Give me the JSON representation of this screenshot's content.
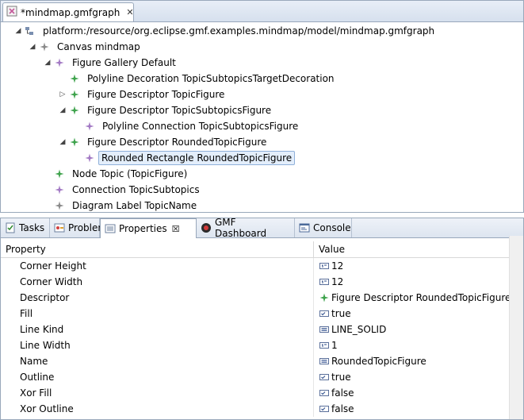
{
  "editor": {
    "tab_label": "*mindmap.gmfgraph",
    "tree": [
      {
        "label": "platform:/resource/org.eclipse.gmf.examples.mindmap/model/mindmap.gmfgraph",
        "twisty": "◢",
        "icon": "resource"
      },
      {
        "label": "Canvas mindmap",
        "twisty": "◢",
        "icon": "gray"
      },
      {
        "label": "Figure Gallery Default",
        "twisty": "◢",
        "icon": "purple"
      },
      {
        "label": "Polyline Decoration TopicSubtopicsTargetDecoration",
        "twisty": "",
        "icon": "green"
      },
      {
        "label": "Figure Descriptor TopicFigure",
        "twisty": "▷",
        "icon": "green"
      },
      {
        "label": "Figure Descriptor TopicSubtopicsFigure",
        "twisty": "◢",
        "icon": "green"
      },
      {
        "label": "Polyline Connection TopicSubtopicsFigure",
        "twisty": "",
        "icon": "purple"
      },
      {
        "label": "Figure Descriptor RoundedTopicFigure",
        "twisty": "◢",
        "icon": "green"
      },
      {
        "label": "Rounded Rectangle RoundedTopicFigure",
        "twisty": "",
        "icon": "purple"
      },
      {
        "label": "Node Topic (TopicFigure)",
        "twisty": "",
        "icon": "green"
      },
      {
        "label": "Connection TopicSubtopics",
        "twisty": "",
        "icon": "purple"
      },
      {
        "label": "Diagram Label TopicName",
        "twisty": "",
        "icon": "gray"
      }
    ]
  },
  "views": {
    "tabs": [
      {
        "label": "Tasks",
        "icon": "tasks"
      },
      {
        "label": "Problems",
        "icon": "problems"
      },
      {
        "label": "Properties",
        "icon": "properties"
      },
      {
        "label": "GMF Dashboard",
        "icon": "dashboard"
      },
      {
        "label": "Console",
        "icon": "console"
      }
    ],
    "properties_close": "☒"
  },
  "properties": {
    "headers": {
      "property": "Property",
      "value": "Value"
    },
    "rows": [
      {
        "name": "Corner Height",
        "value": "12",
        "vicon": "num"
      },
      {
        "name": "Corner Width",
        "value": "12",
        "vicon": "num"
      },
      {
        "name": "Descriptor",
        "value": "Figure Descriptor RoundedTopicFigure",
        "vicon": "green"
      },
      {
        "name": "Fill",
        "value": "true",
        "vicon": "bool"
      },
      {
        "name": "Line Kind",
        "value": "LINE_SOLID",
        "vicon": "enum"
      },
      {
        "name": "Line Width",
        "value": "1",
        "vicon": "num"
      },
      {
        "name": "Name",
        "value": "RoundedTopicFigure",
        "vicon": "enum"
      },
      {
        "name": "Outline",
        "value": "true",
        "vicon": "bool"
      },
      {
        "name": "Xor Fill",
        "value": "false",
        "vicon": "bool"
      },
      {
        "name": "Xor Outline",
        "value": "false",
        "vicon": "bool"
      }
    ]
  }
}
